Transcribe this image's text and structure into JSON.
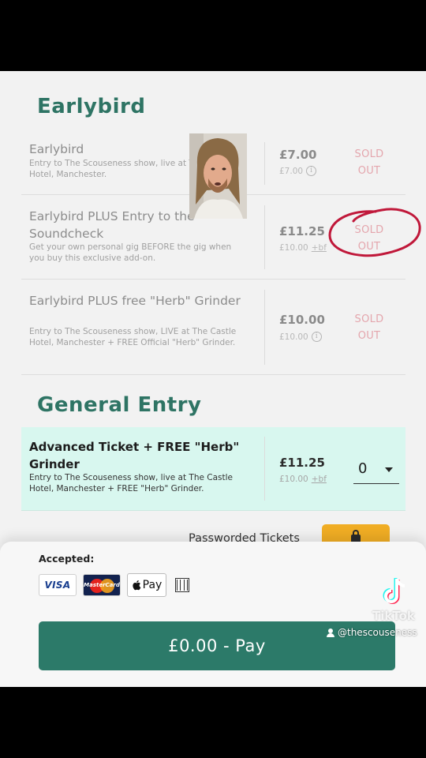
{
  "sections": {
    "earlybird_title": "Earlybird",
    "general_title": "General Entry"
  },
  "tickets": [
    {
      "name": "Earlybird",
      "desc": "Entry to The Scouseness show, live at The Castle Hotel, Manchester.",
      "price": "£7.00",
      "sub": "£7.00",
      "status_line1": "SOLD",
      "status_line2": "OUT"
    },
    {
      "name": "Earlybird PLUS Entry to the Soundcheck",
      "desc": "Get your own personal gig BEFORE the gig when you buy this exclusive add-on.",
      "price": "£11.25",
      "sub": "£10.00",
      "sub_fee": "+bf",
      "status_line1": "SOLD",
      "status_line2": "OUT"
    },
    {
      "name": "Earlybird PLUS free \"Herb\" Grinder",
      "desc": "Entry to The Scouseness show, LIVE at The Castle Hotel, Manchester + FREE Official \"Herb\" Grinder.",
      "price": "£10.00",
      "sub": "£10.00",
      "status_line1": "SOLD",
      "status_line2": "OUT"
    },
    {
      "name": "Advanced Ticket + FREE \"Herb\" Grinder",
      "desc": "Entry to The Scouseness show, live at The Castle Hotel, Manchester + FREE \"Herb\" Grinder.",
      "price": "£11.25",
      "sub": "£10.00",
      "sub_fee": "+bf",
      "quantity": "0"
    }
  ],
  "passworded": {
    "label": "Passworded Tickets",
    "icon": "lock-icon"
  },
  "footer": {
    "accepted_label": "Accepted:",
    "visa": "VISA",
    "mastercard": "MasterCard",
    "apple_pay": "Pay",
    "pay_button": "£0.00 - Pay"
  },
  "overlay": {
    "tiktok_word": "TikTok",
    "handle": "@thescouseness"
  },
  "colors": {
    "brand_green": "#2e7464",
    "pay_green": "#2c7a69",
    "active_row": "#d8f7ef",
    "sold_out": "#e4a6ad",
    "lock_button": "#f0ad24",
    "annotation_circle": "#c0183a"
  }
}
